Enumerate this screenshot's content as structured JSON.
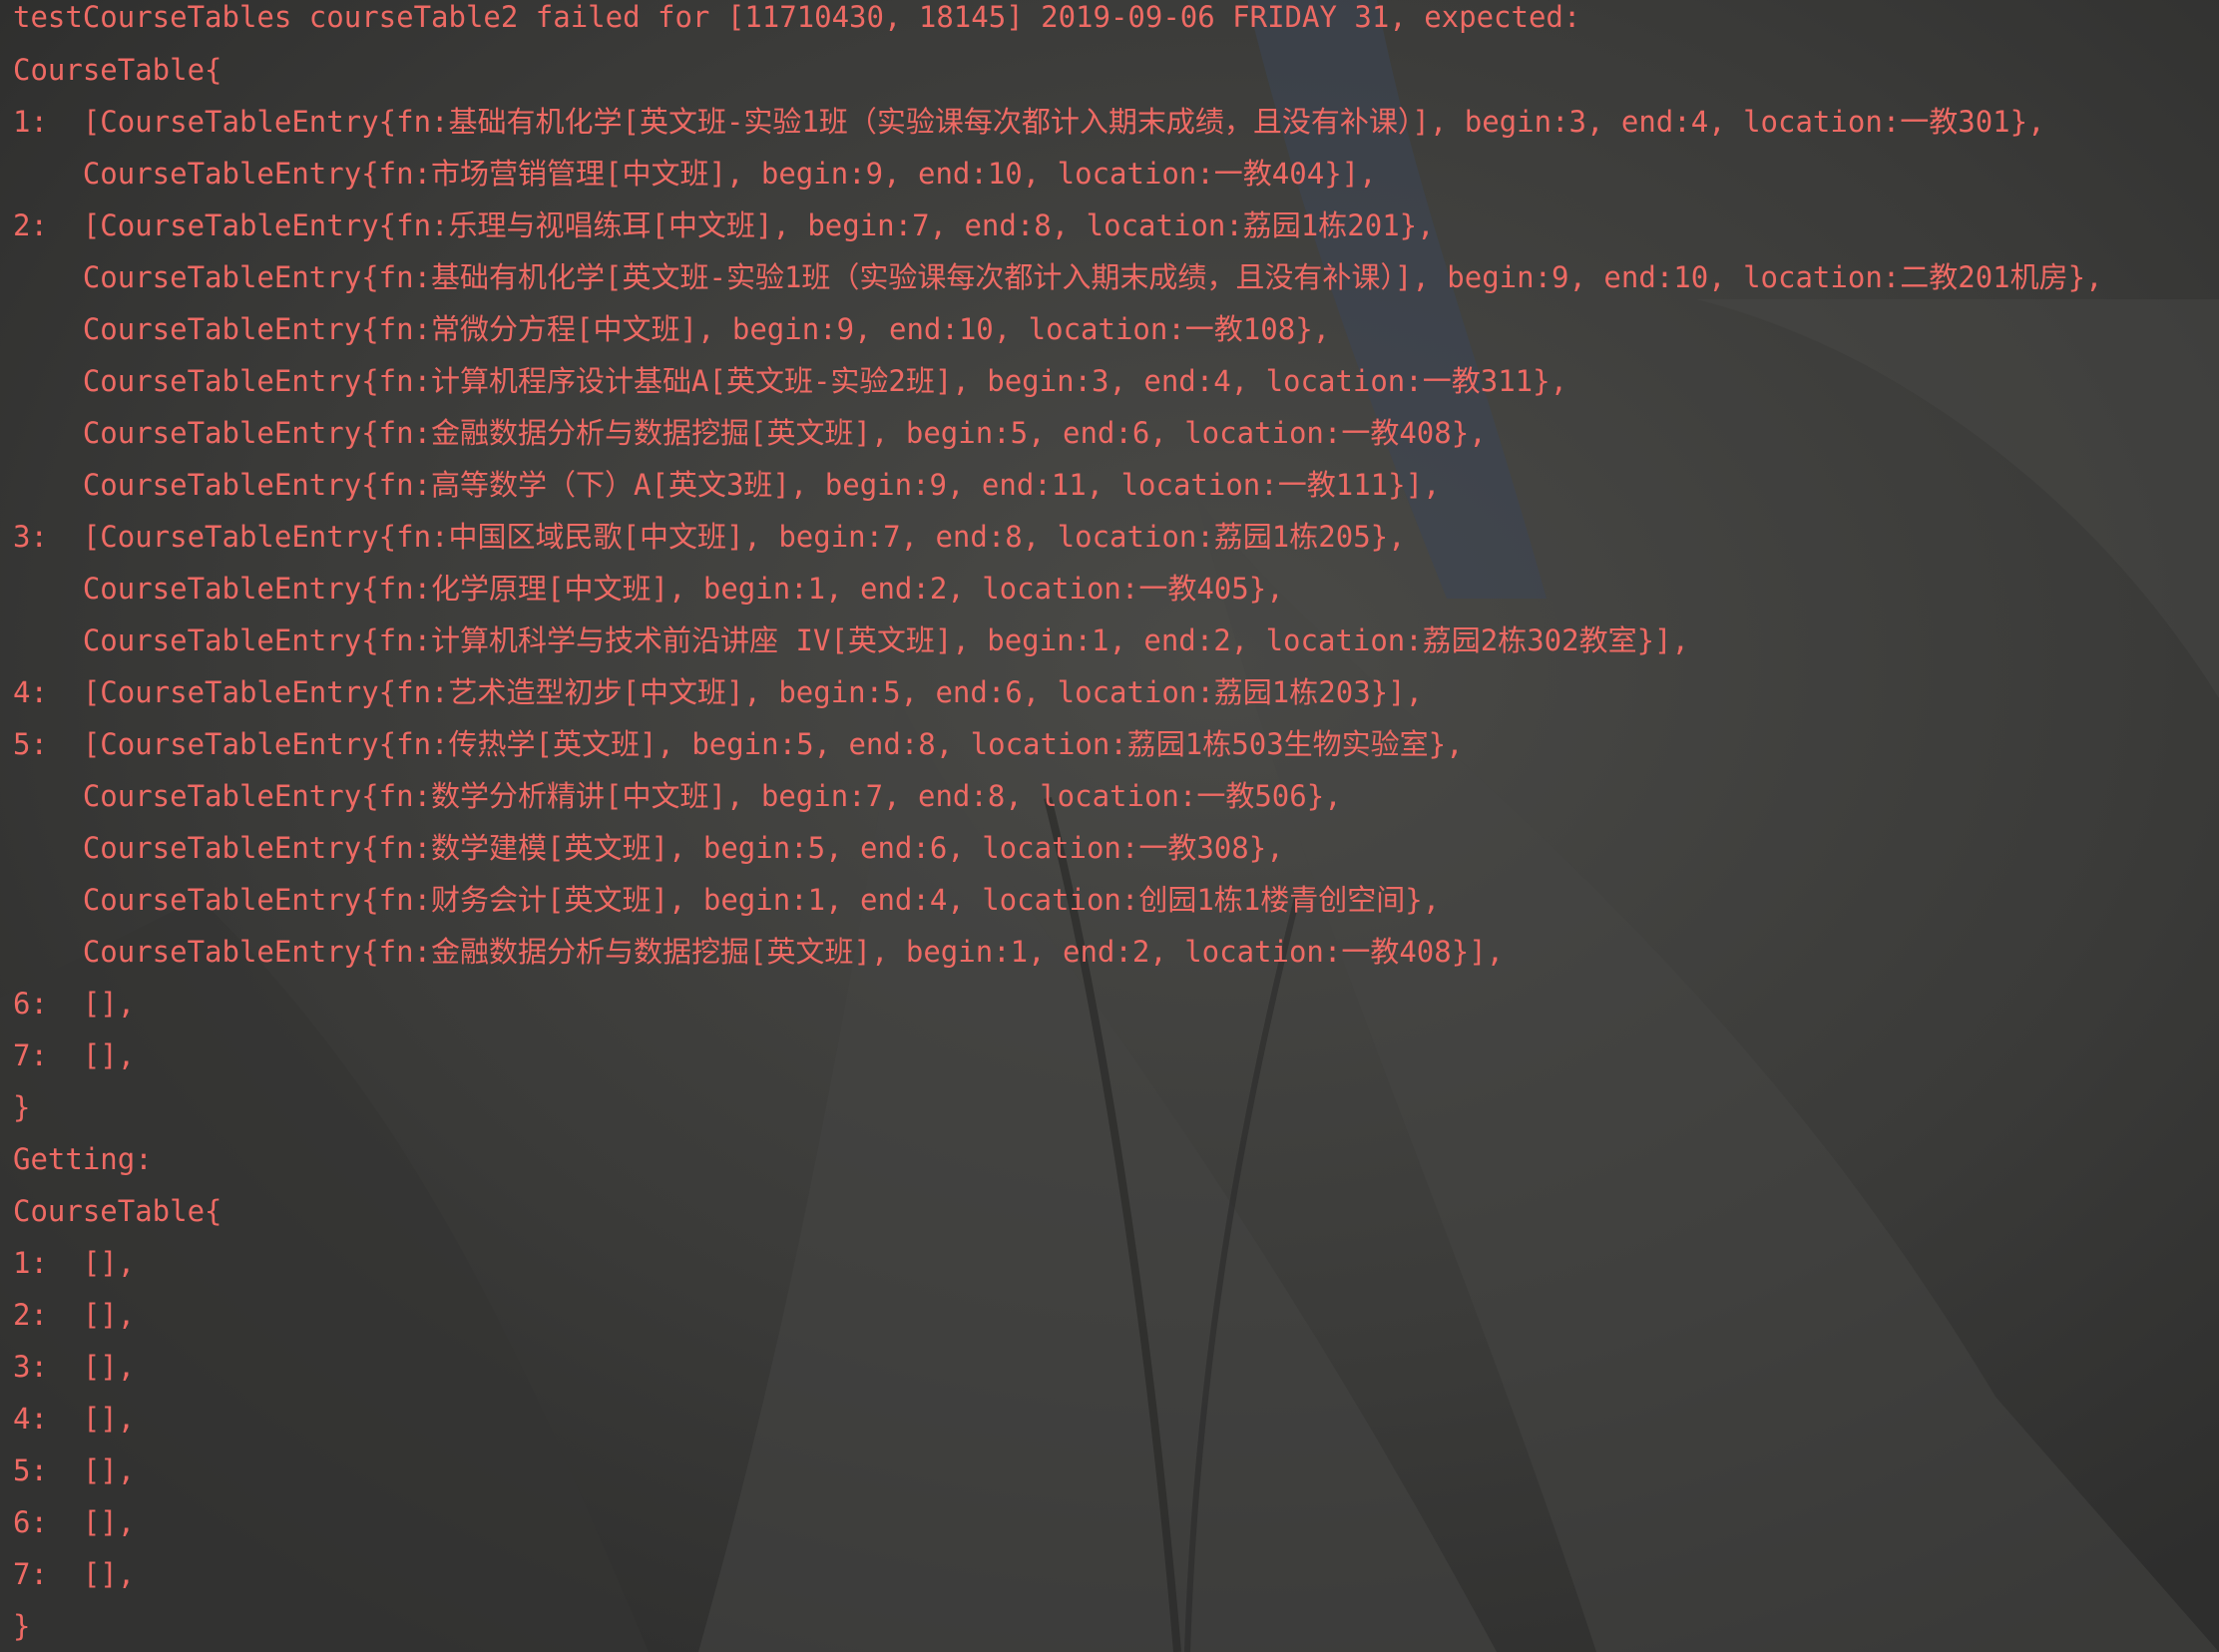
{
  "console": {
    "lines": [
      "testCourseTables courseTable2 failed for [11710430, 18145] 2019-09-06 FRIDAY 31, expected:",
      "CourseTable{",
      "1:  [CourseTableEntry{fn:基础有机化学[英文班-实验1班（实验课每次都计入期末成绩，且没有补课）], begin:3, end:4, location:一教301},",
      "    CourseTableEntry{fn:市场营销管理[中文班], begin:9, end:10, location:一教404}],",
      "2:  [CourseTableEntry{fn:乐理与视唱练耳[中文班], begin:7, end:8, location:荔园1栋201},",
      "    CourseTableEntry{fn:基础有机化学[英文班-实验1班（实验课每次都计入期末成绩，且没有补课）], begin:9, end:10, location:二教201机房},",
      "    CourseTableEntry{fn:常微分方程[中文班], begin:9, end:10, location:一教108},",
      "    CourseTableEntry{fn:计算机程序设计基础A[英文班-实验2班], begin:3, end:4, location:一教311},",
      "    CourseTableEntry{fn:金融数据分析与数据挖掘[英文班], begin:5, end:6, location:一教408},",
      "    CourseTableEntry{fn:高等数学（下）A[英文3班], begin:9, end:11, location:一教111}],",
      "3:  [CourseTableEntry{fn:中国区域民歌[中文班], begin:7, end:8, location:荔园1栋205},",
      "    CourseTableEntry{fn:化学原理[中文班], begin:1, end:2, location:一教405},",
      "    CourseTableEntry{fn:计算机科学与技术前沿讲座 IV[英文班], begin:1, end:2, location:荔园2栋302教室}],",
      "4:  [CourseTableEntry{fn:艺术造型初步[中文班], begin:5, end:6, location:荔园1栋203}],",
      "5:  [CourseTableEntry{fn:传热学[英文班], begin:5, end:8, location:荔园1栋503生物实验室},",
      "    CourseTableEntry{fn:数学分析精讲[中文班], begin:7, end:8, location:一教506},",
      "    CourseTableEntry{fn:数学建模[英文班], begin:5, end:6, location:一教308},",
      "    CourseTableEntry{fn:财务会计[英文班], begin:1, end:4, location:创园1栋1楼青创空间},",
      "    CourseTableEntry{fn:金融数据分析与数据挖掘[英文班], begin:1, end:2, location:一教408}],",
      "6:  [],",
      "7:  [],",
      "}",
      "Getting:",
      "CourseTable{",
      "1:  [],",
      "2:  [],",
      "3:  [],",
      "4:  [],",
      "5:  [],",
      "6:  [],",
      "7:  [],",
      "}"
    ]
  },
  "colors": {
    "error_text": "#ee6a64",
    "background": "#3a3a38"
  }
}
